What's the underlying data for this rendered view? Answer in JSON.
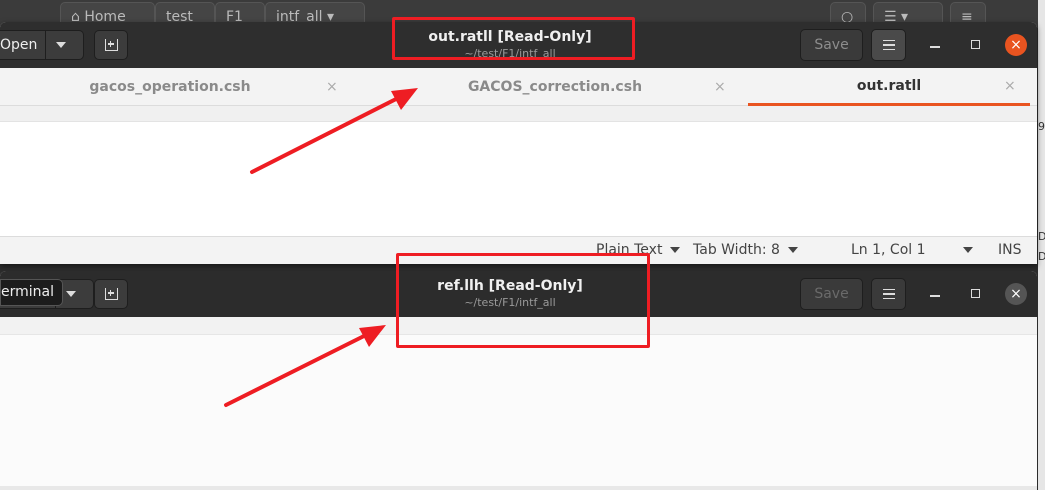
{
  "background_window": {
    "path_segments": [
      "Home",
      "test",
      "F1",
      "intf_all"
    ],
    "right_fragments": [
      "9",
      "D",
      "D"
    ]
  },
  "window1": {
    "open_label": "Open",
    "title": "out.ratll [Read-Only]",
    "subtitle": "~/test/F1/intf_all",
    "save_label": "Save",
    "close_glyph": "×",
    "tabs": [
      {
        "label": "gacos_operation.csh",
        "close": "×"
      },
      {
        "label": "GACOS_correction.csh",
        "close": "×"
      },
      {
        "label": "out.ratll",
        "close": "×"
      }
    ],
    "status": {
      "syntax": "Plain Text",
      "tab_width": "Tab Width: 8",
      "position": "Ln 1, Col 1",
      "mode": "INS"
    }
  },
  "window2": {
    "tooltip": "erminal",
    "title": "ref.llh [Read-Only]",
    "subtitle": "~/test/F1/intf_all",
    "save_label": "Save",
    "close_glyph": "×"
  },
  "colors": {
    "accent": "#e95420",
    "annotation_red": "#ee1d23",
    "headerbar": "#2d2d2d"
  }
}
